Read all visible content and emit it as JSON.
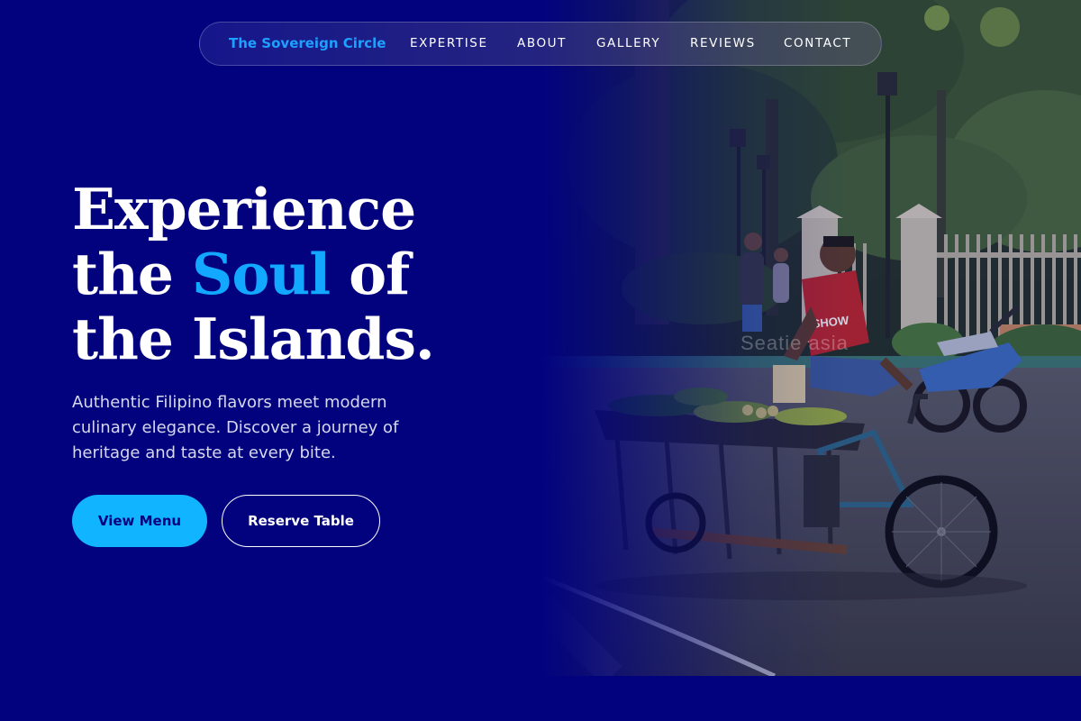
{
  "nav": {
    "brand": "The Sovereign Circle",
    "links": [
      {
        "label": "EXPERTISE"
      },
      {
        "label": "ABOUT"
      },
      {
        "label": "GALLERY"
      },
      {
        "label": "REVIEWS"
      },
      {
        "label": "CONTACT"
      }
    ]
  },
  "hero": {
    "headline": {
      "line1": "Experience",
      "line2_prefix": "the ",
      "line2_accent": "Soul",
      "line2_suffix": " of",
      "line3": "the Islands."
    },
    "description": "Authentic Filipino flavors meet modern culinary elegance. Discover a journey of heritage and taste at every bite.",
    "primary_button": "View Menu",
    "secondary_button": "Reserve Table",
    "image": {
      "subject": "street vendor with fruit cart on tricycle under trees",
      "jersey_text": "SHOW",
      "watermark": "Seatie asia"
    }
  },
  "colors": {
    "background": "#02027f",
    "accent": "#13a8ff",
    "primary_button": "#10b4ff",
    "brand": "#1ea0ff",
    "text": "#ffffff"
  }
}
